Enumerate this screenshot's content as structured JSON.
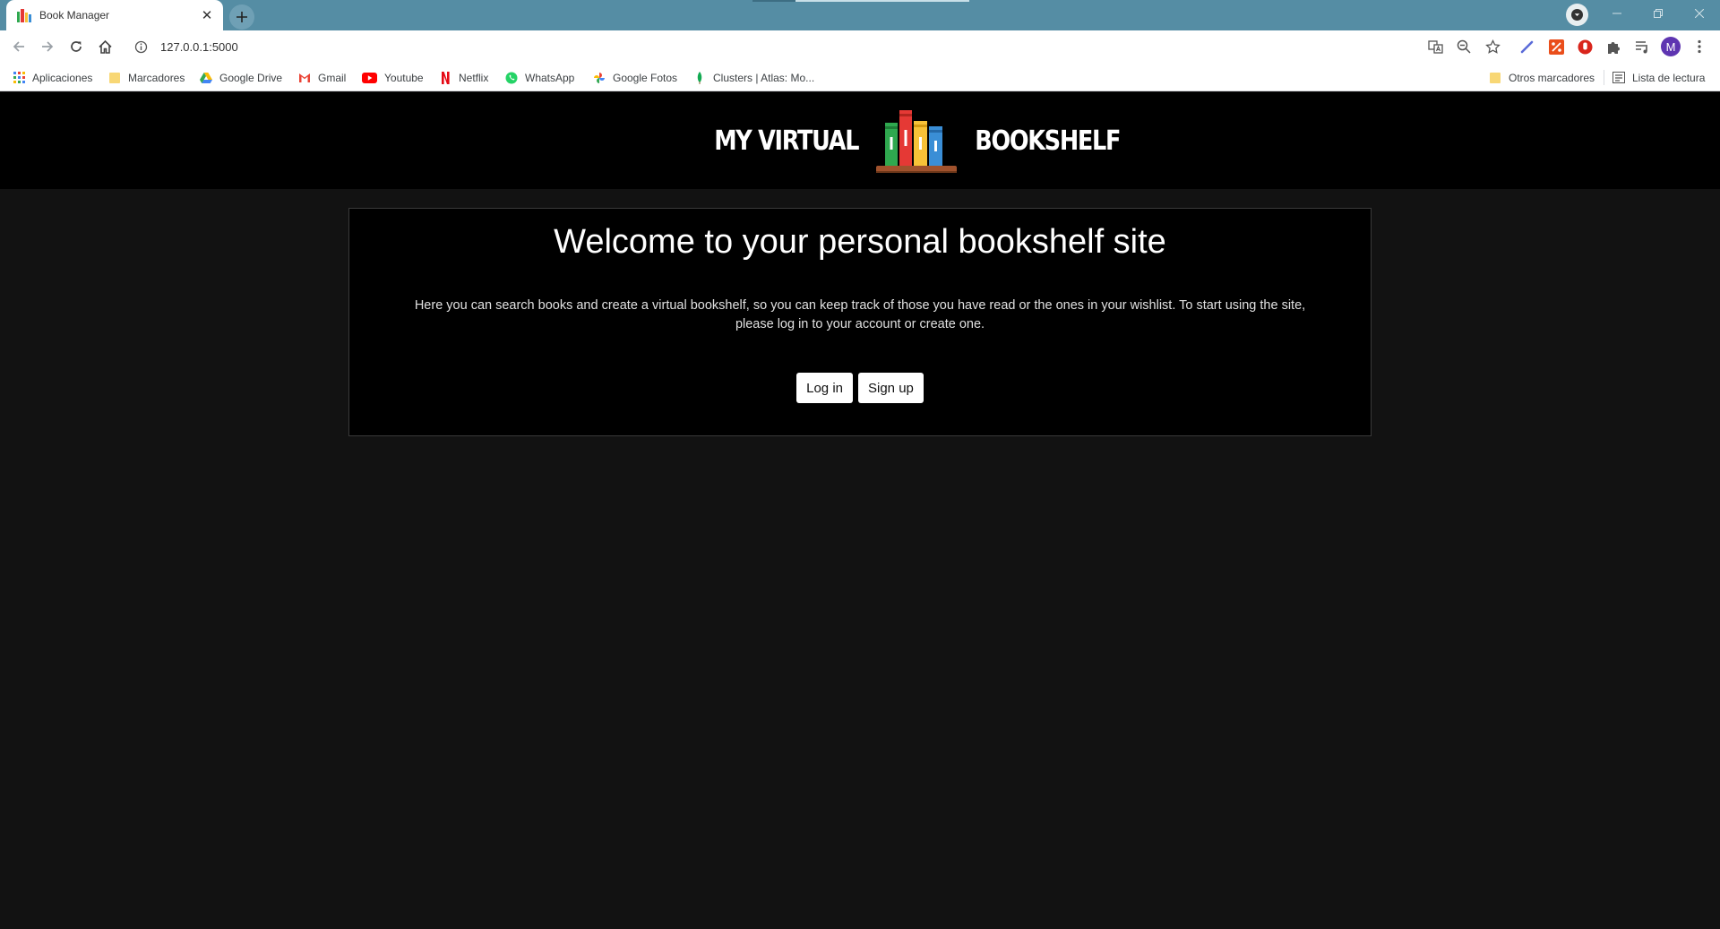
{
  "browser": {
    "tab_title": "Book Manager",
    "close_glyph": "✕",
    "new_tab_glyph": "+",
    "url": "127.0.0.1:5000",
    "profile_initial": "M",
    "bookmarks": [
      {
        "label": "Aplicaciones",
        "icon": "apps-grid-icon"
      },
      {
        "label": "Marcadores",
        "icon": "folder-icon"
      },
      {
        "label": "Google Drive",
        "icon": "google-drive-icon"
      },
      {
        "label": "Gmail",
        "icon": "gmail-icon"
      },
      {
        "label": "Youtube",
        "icon": "youtube-icon"
      },
      {
        "label": "Netflix",
        "icon": "netflix-icon"
      },
      {
        "label": "WhatsApp",
        "icon": "whatsapp-icon"
      },
      {
        "label": "Google Fotos",
        "icon": "google-photos-icon"
      },
      {
        "label": "Clusters | Atlas: Mo...",
        "icon": "mongodb-leaf-icon"
      }
    ],
    "other_bookmarks": "Otros marcadores",
    "reading_list": "Lista de lectura"
  },
  "site": {
    "logo_left": "MY VIRTUAL",
    "logo_right": "BOOKSHELF",
    "welcome_title": "Welcome to your personal bookshelf site",
    "welcome_line1": "Here you can search books and create a virtual bookshelf, so you can keep track of those you have read or the ones in your wishlist. To start using the site,",
    "welcome_line2": "please log in to your account or create one.",
    "login_label": "Log in",
    "signup_label": "Sign up"
  },
  "colors": {
    "tabstrip": "#558da4",
    "header_bg": "#000000",
    "page_bg": "#121212",
    "book_green": "#2fa84f",
    "book_red": "#e53935",
    "book_yellow": "#f7c238",
    "book_blue": "#3a8ed6",
    "shelf_brown": "#a0522d"
  }
}
